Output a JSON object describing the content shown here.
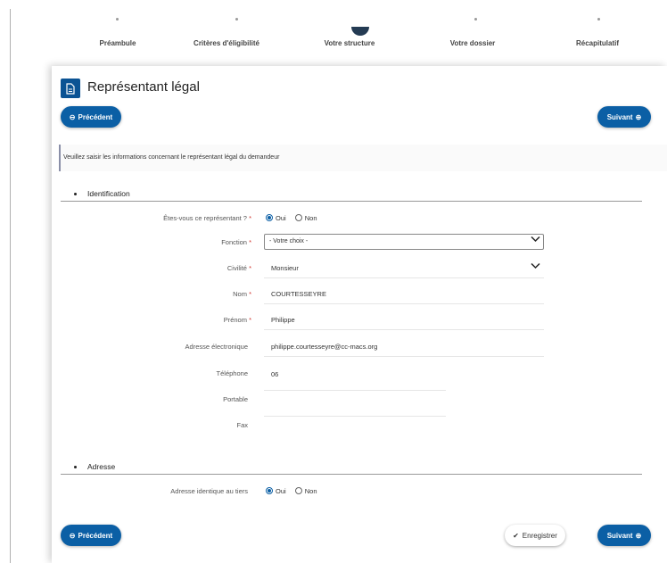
{
  "stepper": {
    "steps": [
      {
        "label": "Préambule"
      },
      {
        "label": "Critères d'éligibilité"
      },
      {
        "label": "Votre structure"
      },
      {
        "label": "Votre dossier"
      },
      {
        "label": "Récapitulatif"
      }
    ],
    "active_index": 2
  },
  "page": {
    "title": "Représentant légal",
    "info_text": "Veuillez saisir les informations concernant le représentant légal du demandeur"
  },
  "buttons": {
    "previous": "Précédent",
    "next": "Suivant",
    "save": "Enregistrer"
  },
  "identification": {
    "section_title": "Identification",
    "is_representative": {
      "label": "Êtes-vous ce représentant ?",
      "required_mark": "*",
      "options": [
        "Oui",
        "Non"
      ],
      "selected": "Oui"
    },
    "fonction": {
      "label": "Fonction",
      "required_mark": "*",
      "value": "- Votre choix -"
    },
    "civilite": {
      "label": "Civilité",
      "required_mark": "*",
      "value": "Monsieur"
    },
    "nom": {
      "label": "Nom",
      "required_mark": "*",
      "value": "COURTESSEYRE"
    },
    "prenom": {
      "label": "Prénom",
      "required_mark": "*",
      "value": "Philippe"
    },
    "email": {
      "label": "Adresse électronique",
      "value": "philippe.courtesseyre@cc-macs.org"
    },
    "telephone": {
      "label": "Téléphone",
      "value": "06"
    },
    "portable": {
      "label": "Portable",
      "value": ""
    },
    "fax": {
      "label": "Fax",
      "value": ""
    }
  },
  "adresse": {
    "section_title": "Adresse",
    "identique": {
      "label": "Adresse identique au tiers",
      "options": [
        "Oui",
        "Non"
      ],
      "selected": "Oui"
    }
  },
  "colors": {
    "primary": "#0b5fa5",
    "title_icon": "#0b5394",
    "required": "#d0342c",
    "stepper_active": "#243b53"
  },
  "icons": {
    "title": "document-icon",
    "previous": "arrow-left-circle-icon",
    "next": "arrow-right-circle-icon",
    "save": "check-circle-icon",
    "select": "chevron-down-icon"
  }
}
